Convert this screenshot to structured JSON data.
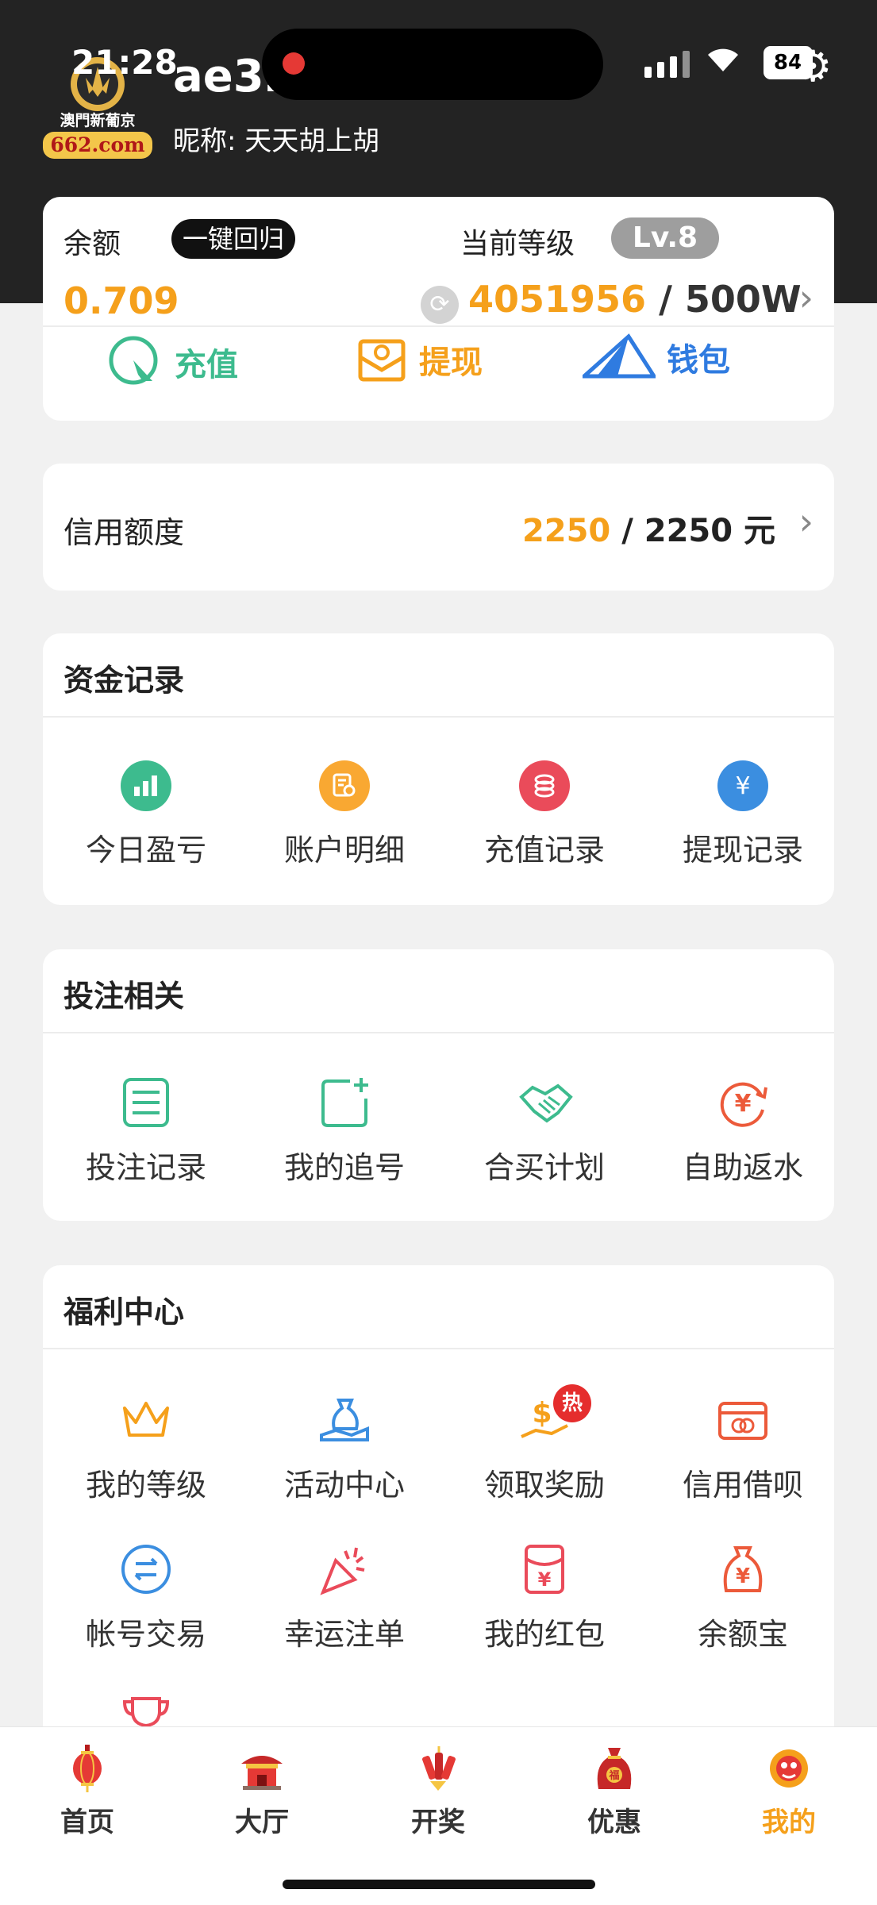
{
  "status_bar": {
    "time": "21:28",
    "battery": "84"
  },
  "header": {
    "logo_text_top": "澳門新葡京",
    "logo_text_bottom": "662.com",
    "username": "ae32",
    "nickname": "昵称: 天天胡上胡"
  },
  "balance_card": {
    "balance_label": "余额",
    "reclaim_button": "一键回归",
    "level_label": "当前等级",
    "level_badge": "Lv.8",
    "balance_value": "0.709",
    "exp_current": "4051956",
    "exp_separator": " / ",
    "exp_target": "500W",
    "actions": [
      {
        "label": "充值",
        "color": "#3dbb8e"
      },
      {
        "label": "提现",
        "color": "#f5a01b"
      },
      {
        "label": "钱包",
        "color": "#2f7be0"
      }
    ]
  },
  "credit_card": {
    "label": "信用额度",
    "used": "2250",
    "separator": " / ",
    "total": "2250 元"
  },
  "fund_records": {
    "title": "资金记录",
    "items": [
      {
        "label": "今日盈亏",
        "icon": "bar-chart-icon",
        "color": "#3dbb8e"
      },
      {
        "label": "账户明细",
        "icon": "document-search-icon",
        "color": "#f9a832"
      },
      {
        "label": "充值记录",
        "icon": "coins-icon",
        "color": "#ea4b5a"
      },
      {
        "label": "提现记录",
        "icon": "yuan-transfer-icon",
        "color": "#3b8ee0"
      }
    ]
  },
  "betting": {
    "title": "投注相关",
    "items": [
      {
        "label": "投注记录",
        "icon": "list-icon"
      },
      {
        "label": "我的追号",
        "icon": "add-square-icon"
      },
      {
        "label": "合买计划",
        "icon": "handshake-icon"
      },
      {
        "label": "自助返水",
        "icon": "yuan-refresh-icon"
      }
    ]
  },
  "welfare": {
    "title": "福利中心",
    "hot_badge": "热",
    "items": [
      {
        "label": "我的等级",
        "icon": "crown-icon"
      },
      {
        "label": "活动中心",
        "icon": "money-bag-hand-icon"
      },
      {
        "label": "领取奖励",
        "icon": "reward-hand-icon"
      },
      {
        "label": "信用借呗",
        "icon": "credit-card-icon"
      },
      {
        "label": "帐号交易",
        "icon": "exchange-icon"
      },
      {
        "label": "幸运注单",
        "icon": "party-popper-icon"
      },
      {
        "label": "我的红包",
        "icon": "red-envelope-icon"
      },
      {
        "label": "余额宝",
        "icon": "yuan-bag-icon"
      },
      {
        "label": "",
        "icon": "trophy-icon"
      }
    ]
  },
  "tabbar": {
    "active_color": "#f5a01b",
    "tabs": [
      {
        "label": "首页",
        "icon": "lantern-icon"
      },
      {
        "label": "大厅",
        "icon": "pavilion-icon"
      },
      {
        "label": "开奖",
        "icon": "firecracker-icon"
      },
      {
        "label": "优惠",
        "icon": "lucky-bag-icon"
      },
      {
        "label": "我的",
        "icon": "lion-dance-icon"
      }
    ]
  }
}
